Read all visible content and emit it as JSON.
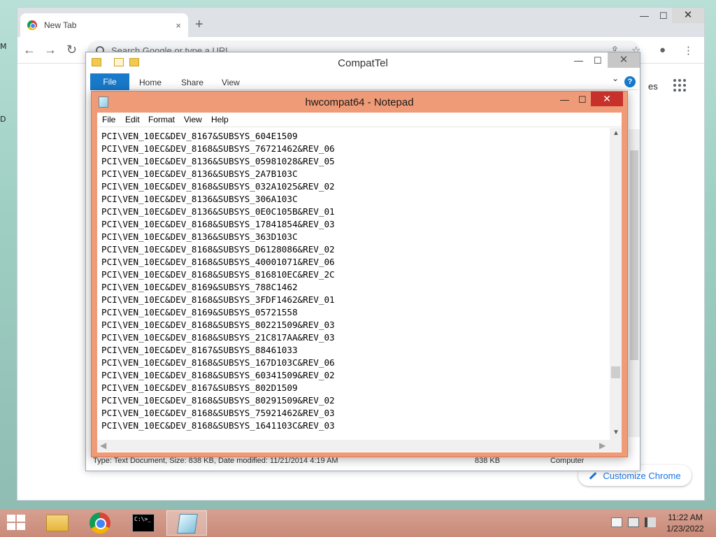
{
  "desktop": {
    "stub_a": "M",
    "stub_b": "D"
  },
  "chrome": {
    "tab_title": "New Tab",
    "tab_close": "×",
    "new_tab": "+",
    "ctrl_min": "—",
    "ctrl_max": "☐",
    "ctrl_close": "✕",
    "nav_back": "←",
    "nav_forward": "→",
    "nav_reload": "↻",
    "omnibox_placeholder": "Search Google or type a URL",
    "images_link": "es",
    "customize_label": "Customize Chrome"
  },
  "explorer": {
    "title": "CompatTel",
    "ctrl_min": "—",
    "ctrl_max": "☐",
    "ctrl_close": "✕",
    "ribbon_file": "File",
    "ribbon_tabs": [
      "Home",
      "Share",
      "View"
    ],
    "ribbon_chevron": "⌄",
    "help": "?",
    "status_left": "Type: Text Document, Size: 838 KB, Date modified: 11/21/2014 4:19 AM",
    "status_size": "838 KB",
    "status_location": "Computer"
  },
  "notepad": {
    "title": "hwcompat64 - Notepad",
    "ctrl_min": "—",
    "ctrl_max": "☐",
    "ctrl_close": "✕",
    "menu": [
      "File",
      "Edit",
      "Format",
      "View",
      "Help"
    ],
    "lines": [
      "PCI\\VEN_10EC&DEV_8167&SUBSYS_604E1509",
      "PCI\\VEN_10EC&DEV_8168&SUBSYS_76721462&REV_06",
      "PCI\\VEN_10EC&DEV_8136&SUBSYS_05981028&REV_05",
      "PCI\\VEN_10EC&DEV_8136&SUBSYS_2A7B103C",
      "PCI\\VEN_10EC&DEV_8168&SUBSYS_032A1025&REV_02",
      "PCI\\VEN_10EC&DEV_8136&SUBSYS_306A103C",
      "PCI\\VEN_10EC&DEV_8136&SUBSYS_0E0C105B&REV_01",
      "PCI\\VEN_10EC&DEV_8168&SUBSYS_17841854&REV_03",
      "PCI\\VEN_10EC&DEV_8136&SUBSYS_363D103C",
      "PCI\\VEN_10EC&DEV_8168&SUBSYS_D6128086&REV_02",
      "PCI\\VEN_10EC&DEV_8168&SUBSYS_40001071&REV_06",
      "PCI\\VEN_10EC&DEV_8168&SUBSYS_816810EC&REV_2C",
      "PCI\\VEN_10EC&DEV_8169&SUBSYS_788C1462",
      "PCI\\VEN_10EC&DEV_8168&SUBSYS_3FDF1462&REV_01",
      "PCI\\VEN_10EC&DEV_8169&SUBSYS_05721558",
      "PCI\\VEN_10EC&DEV_8168&SUBSYS_80221509&REV_03",
      "PCI\\VEN_10EC&DEV_8168&SUBSYS_21C817AA&REV_03",
      "PCI\\VEN_10EC&DEV_8167&SUBSYS_88461033",
      "PCI\\VEN_10EC&DEV_8168&SUBSYS_167D103C&REV_06",
      "PCI\\VEN_10EC&DEV_8168&SUBSYS_60341509&REV_02",
      "PCI\\VEN_10EC&DEV_8167&SUBSYS_802D1509",
      "PCI\\VEN_10EC&DEV_8168&SUBSYS_80291509&REV_02",
      "PCI\\VEN_10EC&DEV_8168&SUBSYS_75921462&REV_03",
      "PCI\\VEN_10EC&DEV_8168&SUBSYS_1641103C&REV_03"
    ],
    "scroll_up": "▲",
    "scroll_down": "▼",
    "scroll_left": "◀",
    "scroll_right": "▶"
  },
  "taskbar": {
    "apps": [
      "file-explorer",
      "google-chrome",
      "command-prompt",
      "notepad"
    ],
    "cmd_glyph": "C:\\>_",
    "time": "11:22 AM",
    "date": "1/23/2022"
  },
  "colors": {
    "notepad_frame": "#ef9b78",
    "notepad_close": "#c7312b",
    "ribbon_file": "#1979ca",
    "taskbar": "#d7a091",
    "chrome_accent": "#1a73e8"
  }
}
